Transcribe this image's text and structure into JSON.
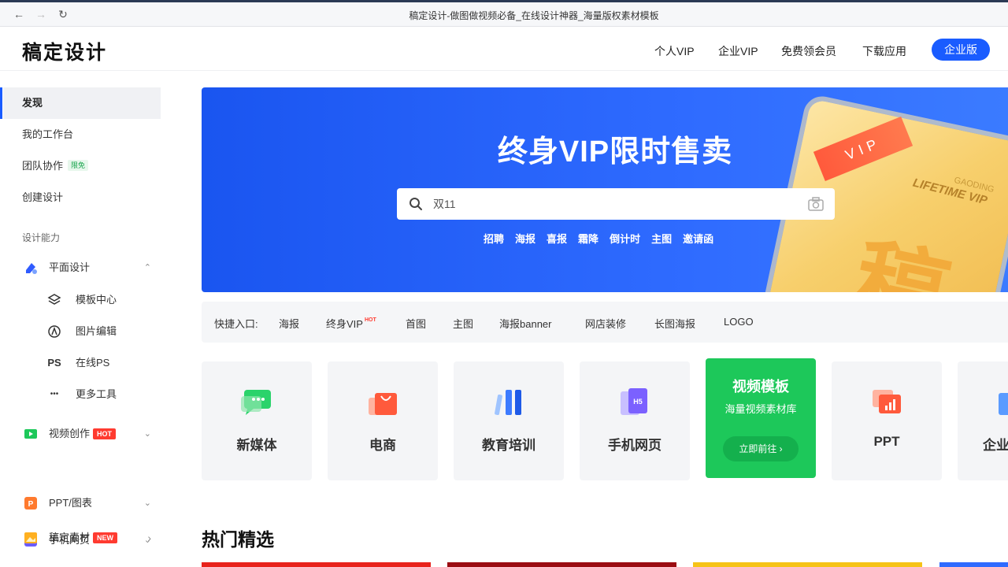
{
  "browser": {
    "back": "←",
    "forward": "→",
    "reload": "↻",
    "tab_title": "稿定设计-做图做视频必备_在线设计神器_海量版权素材模板"
  },
  "header": {
    "logo": "稿定设计",
    "nav": [
      "个人VIP",
      "企业VIP",
      "免费领会员",
      "下载应用"
    ],
    "enterprise_button": "企业版"
  },
  "sidebar": {
    "items": [
      {
        "label": "发现",
        "active": true
      },
      {
        "label": "我的工作台"
      },
      {
        "label": "团队协作",
        "tag": "限免"
      },
      {
        "label": "创建设计"
      }
    ],
    "section_label": "设计能力",
    "categories": [
      {
        "label": "平面设计",
        "chevron": "⌃",
        "icon": "design-icon",
        "color": "#2f5bff"
      },
      {
        "label": "视频创作",
        "tag": "HOT",
        "chevron": "⌄",
        "icon": "video-icon",
        "color": "#1dc85a"
      },
      {
        "label": "手机网页",
        "chevron": "⌄",
        "icon": "h5-icon",
        "color": "#6b5cff"
      },
      {
        "label": "PPT/图表",
        "chevron": "⌄",
        "icon": "ppt-icon",
        "color": "#ff7a2e"
      },
      {
        "label": "稿定素材",
        "tag": "NEW",
        "chevron": "›",
        "icon": "material-icon",
        "color": "#ffb020"
      }
    ],
    "sub_items": [
      {
        "label": "模板中心",
        "icon": "layers-icon"
      },
      {
        "label": "图片编辑",
        "icon": "edit-icon"
      },
      {
        "label": "在线PS",
        "icon": "ps-icon",
        "glyph": "PS"
      },
      {
        "label": "更多工具",
        "icon": "more-icon",
        "glyph": "•••"
      }
    ]
  },
  "banner": {
    "headline": "终身VIP限时售卖",
    "search_placeholder": "双11",
    "hot_words": [
      "招聘",
      "海报",
      "喜报",
      "霜降",
      "倒计时",
      "主图",
      "邀请函"
    ],
    "card_ribbon": "VIP",
    "card_brand": "GAODING",
    "card_tagline": "LIFETIME VIP",
    "card_char": "稿"
  },
  "quick_entry": {
    "label": "快捷入口:",
    "links": [
      {
        "label": "海报"
      },
      {
        "label": "终身VIP",
        "badge": "HOT"
      },
      {
        "label": "首图"
      },
      {
        "label": "主图"
      },
      {
        "label": "海报banner"
      },
      {
        "label": "网店装修"
      },
      {
        "label": "长图海报"
      },
      {
        "label": "LOGO"
      }
    ]
  },
  "tiles": [
    {
      "label": "新媒体",
      "icon": "chat-icon"
    },
    {
      "label": "电商",
      "icon": "shopping-bag-icon"
    },
    {
      "label": "教育培训",
      "icon": "books-icon"
    },
    {
      "label": "手机网页",
      "icon": "h5-page-icon"
    },
    {
      "label": "PPT",
      "icon": "ppt-chart-icon"
    },
    {
      "label": "企业",
      "icon": "enterprise-icon"
    }
  ],
  "video_tile": {
    "title": "视频模板",
    "subtitle": "海量视频素材库",
    "button": "立即前往 ›"
  },
  "section": {
    "title": "热门精选"
  },
  "colors": {
    "brand_blue": "#1a5cff",
    "green": "#1dc85a",
    "hot_red": "#ff3b30"
  }
}
